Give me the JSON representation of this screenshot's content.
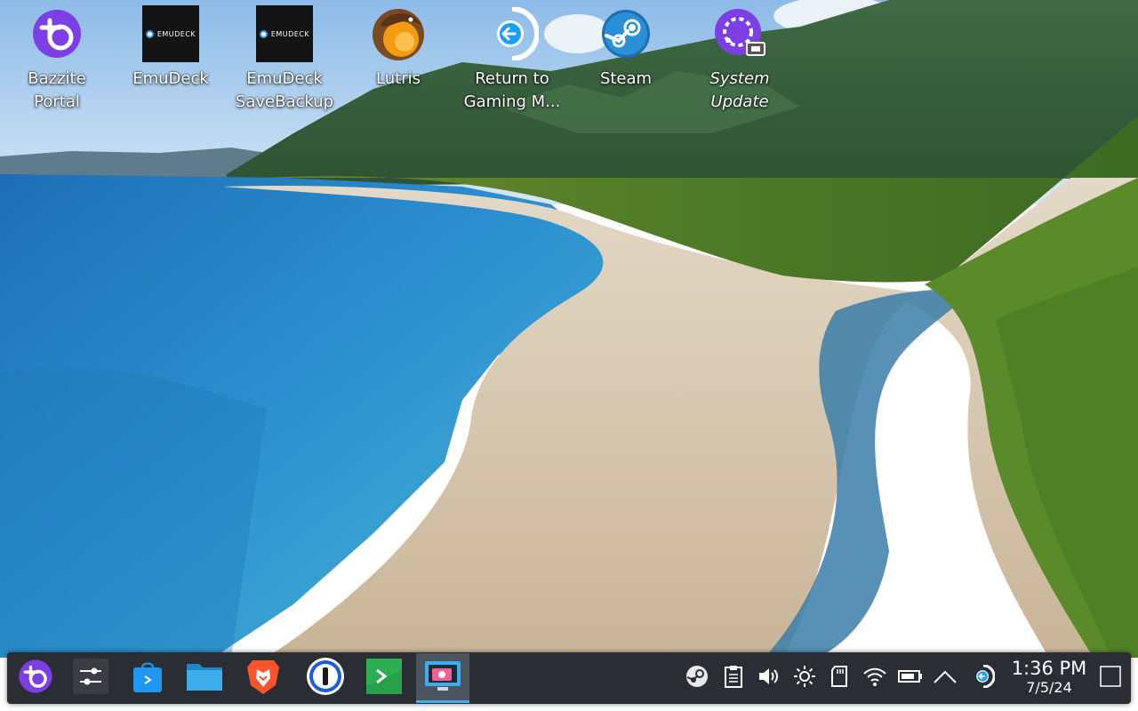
{
  "desktop": {
    "icons": [
      {
        "name": "bazzite-portal",
        "label": "Bazzite\nPortal",
        "icon": "bazzite-logo-icon"
      },
      {
        "name": "emudeck",
        "label": "EmuDeck",
        "icon": "emudeck-icon",
        "tile_text": "EMUDECK"
      },
      {
        "name": "emudeck-savebackup",
        "label": "EmuDeck\nSaveBackup",
        "icon": "emudeck-icon",
        "tile_text": "EMUDECK"
      },
      {
        "name": "lutris",
        "label": "Lutris",
        "icon": "lutris-otter-icon"
      },
      {
        "name": "return-to-gaming-mode",
        "label": "Return to\nGaming M...",
        "icon": "return-arrow-icon"
      },
      {
        "name": "steam",
        "label": "Steam",
        "icon": "steam-icon"
      },
      {
        "name": "system-update",
        "label": "System\nUpdate",
        "icon": "system-update-icon"
      }
    ]
  },
  "taskbar": {
    "apps": [
      {
        "name": "bazzite-menu",
        "icon": "bazzite-logo-icon"
      },
      {
        "name": "system-settings",
        "icon": "settings-sliders-icon"
      },
      {
        "name": "discover-store",
        "icon": "store-bag-icon"
      },
      {
        "name": "file-manager",
        "icon": "folder-icon"
      },
      {
        "name": "brave-browser",
        "icon": "brave-lion-icon"
      },
      {
        "name": "1password",
        "icon": "1password-icon"
      },
      {
        "name": "terminal",
        "icon": "terminal-icon"
      },
      {
        "name": "screenshot-tool",
        "icon": "screenshot-icon",
        "active": true
      }
    ],
    "tray": [
      {
        "name": "steam-tray",
        "icon": "steam-tray-icon"
      },
      {
        "name": "clipboard",
        "icon": "clipboard-icon"
      },
      {
        "name": "volume",
        "icon": "speaker-icon"
      },
      {
        "name": "brightness",
        "icon": "brightness-icon"
      },
      {
        "name": "sd-card",
        "icon": "sd-card-icon"
      },
      {
        "name": "wifi",
        "icon": "wifi-icon"
      },
      {
        "name": "battery",
        "icon": "battery-icon"
      },
      {
        "name": "tray-expand",
        "icon": "chevron-up-icon"
      },
      {
        "name": "return-gaming",
        "icon": "return-arrow-icon"
      }
    ],
    "clock": {
      "time": "1:36 PM",
      "date": "7/5/24"
    },
    "show_desktop_icon": "show-desktop-icon"
  },
  "colors": {
    "bazzite_purple": "#7b3fe4",
    "steam_blue": "#1a9fff",
    "lutris_orange": "#f39c12",
    "taskbar_bg": "#2a2d33",
    "accent": "#3daee9"
  }
}
